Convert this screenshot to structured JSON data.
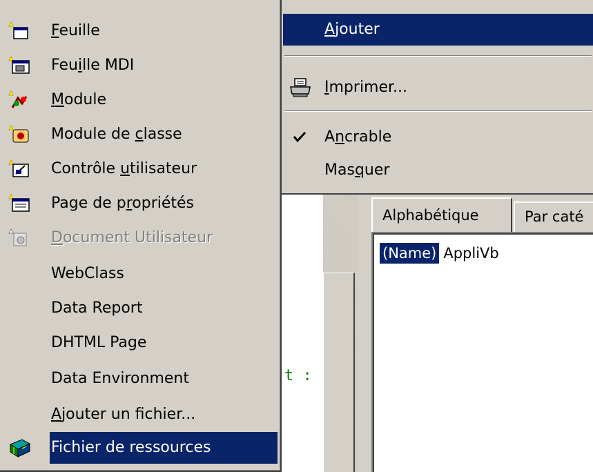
{
  "context_menu": {
    "items": [
      {
        "label_pre": "",
        "mnemonic": "A",
        "label_post": "jouter",
        "highlighted": true
      },
      {
        "label_pre": "",
        "mnemonic": "I",
        "label_post": "mprimer...",
        "icon": "printer-icon"
      },
      {
        "label_pre": "A",
        "mnemonic": "n",
        "label_post": "crable",
        "checked": true,
        "icon": "checkmark-icon"
      },
      {
        "label_pre": "Mas",
        "mnemonic": "q",
        "label_post": "uer"
      }
    ]
  },
  "submenu": {
    "items": [
      {
        "label_pre": "",
        "mnemonic": "F",
        "label_post": "euille",
        "icon": "form-icon"
      },
      {
        "label_pre": "Feu",
        "mnemonic": "i",
        "label_post": "lle MDI",
        "icon": "mdi-form-icon"
      },
      {
        "label_pre": "",
        "mnemonic": "M",
        "label_post": "odule",
        "icon": "module-icon"
      },
      {
        "label_pre": "Module de ",
        "mnemonic": "c",
        "label_post": "lasse",
        "icon": "class-module-icon"
      },
      {
        "label_pre": "Contrôle ",
        "mnemonic": "u",
        "label_post": "tilisateur",
        "icon": "user-control-icon"
      },
      {
        "label_pre": "Page de p",
        "mnemonic": "r",
        "label_post": "opriétés",
        "icon": "property-page-icon"
      },
      {
        "label_pre": "",
        "mnemonic": "D",
        "label_post": "ocument Utilisateur",
        "icon": "user-document-icon",
        "disabled": true
      },
      {
        "label_pre": "WebClass",
        "mnemonic": "",
        "label_post": ""
      },
      {
        "label_pre": "Data Report",
        "mnemonic": "",
        "label_post": ""
      },
      {
        "label_pre": "DHTML Page",
        "mnemonic": "",
        "label_post": ""
      },
      {
        "label_pre": "Data Environment",
        "mnemonic": "",
        "label_post": ""
      },
      {
        "label_pre": "",
        "mnemonic": "A",
        "label_post": "jouter un fichier...",
        "underline_all": true
      },
      {
        "label_pre": "Fichier de ressources",
        "mnemonic": "",
        "label_post": "",
        "icon": "resource-file-icon",
        "highlighted": true
      }
    ]
  },
  "properties": {
    "tabs": [
      "Alphabétique",
      "Par caté"
    ],
    "row": {
      "name": "(Name)",
      "value": "AppliVb"
    }
  },
  "code_fragment": "t :",
  "colors": {
    "menu_bg": "#d4d0c8",
    "highlight": "#0a246a",
    "disabled_text": "#808080",
    "code_text": "#008000"
  }
}
